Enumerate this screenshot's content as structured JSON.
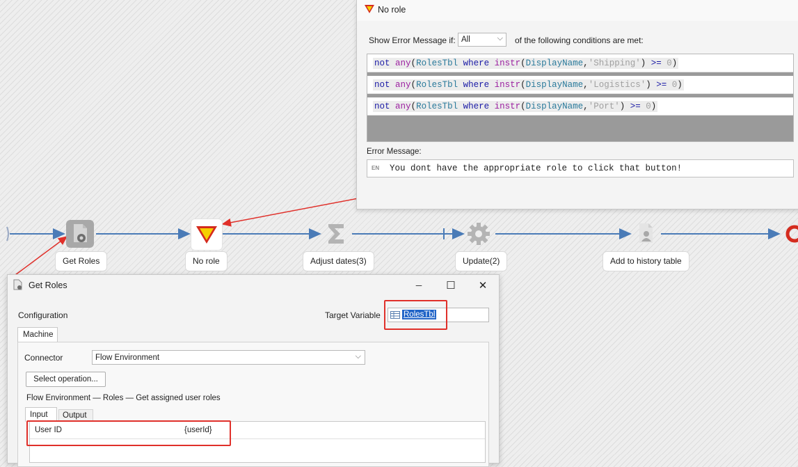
{
  "flow": {
    "nodes": [
      {
        "label": "Get Roles",
        "icon": "get-roles-icon"
      },
      {
        "label": "No role",
        "icon": "validation-triangle-icon"
      },
      {
        "label": "Adjust dates(3)",
        "icon": "sigma-icon"
      },
      {
        "label": "Update(2)",
        "icon": "gear-icon"
      },
      {
        "label": "Add to history table",
        "icon": "user-doc-icon"
      }
    ]
  },
  "norole": {
    "title": "No role",
    "show_error_label": "Show Error Message if:",
    "condition_mode": "All",
    "conditions_suffix": "of the following conditions are met:",
    "conditions": [
      {
        "not": "not",
        "any": "any",
        "table": "RolesTbl",
        "where": "where",
        "instr": "instr",
        "field": "DisplayName",
        "str": "'Shipping'",
        "op": ">=",
        "num": "0"
      },
      {
        "not": "not",
        "any": "any",
        "table": "RolesTbl",
        "where": "where",
        "instr": "instr",
        "field": "DisplayName",
        "str": "'Logistics'",
        "op": ">=",
        "num": "0"
      },
      {
        "not": "not",
        "any": "any",
        "table": "RolesTbl",
        "where": "where",
        "instr": "instr",
        "field": "DisplayName",
        "str": "'Port'",
        "op": ">=",
        "num": "0"
      }
    ],
    "error_message_label": "Error Message:",
    "lang_badge": "EN",
    "error_message": "You dont have the appropriate role to click that button!"
  },
  "getroles": {
    "title": "Get Roles",
    "minimize": "─",
    "maximize": "☐",
    "close": "✕",
    "configuration_label": "Configuration",
    "target_variable_label": "Target Variable",
    "target_variable_value": "RolesTbl",
    "machine_tab": "Machine",
    "connector_label": "Connector",
    "connector_value": "Flow Environment",
    "select_operation_label": "Select operation...",
    "operation_path": "Flow Environment — Roles — Get assigned user roles",
    "input_tab": "Input",
    "output_tab": "Output",
    "param_name": "User ID",
    "param_value": "{userId}"
  },
  "colors": {
    "connector_line": "#4a7bb7",
    "annotation_red": "#e0302a",
    "triangle_yellow": "#f5d000",
    "triangle_red": "#d42b1e"
  }
}
